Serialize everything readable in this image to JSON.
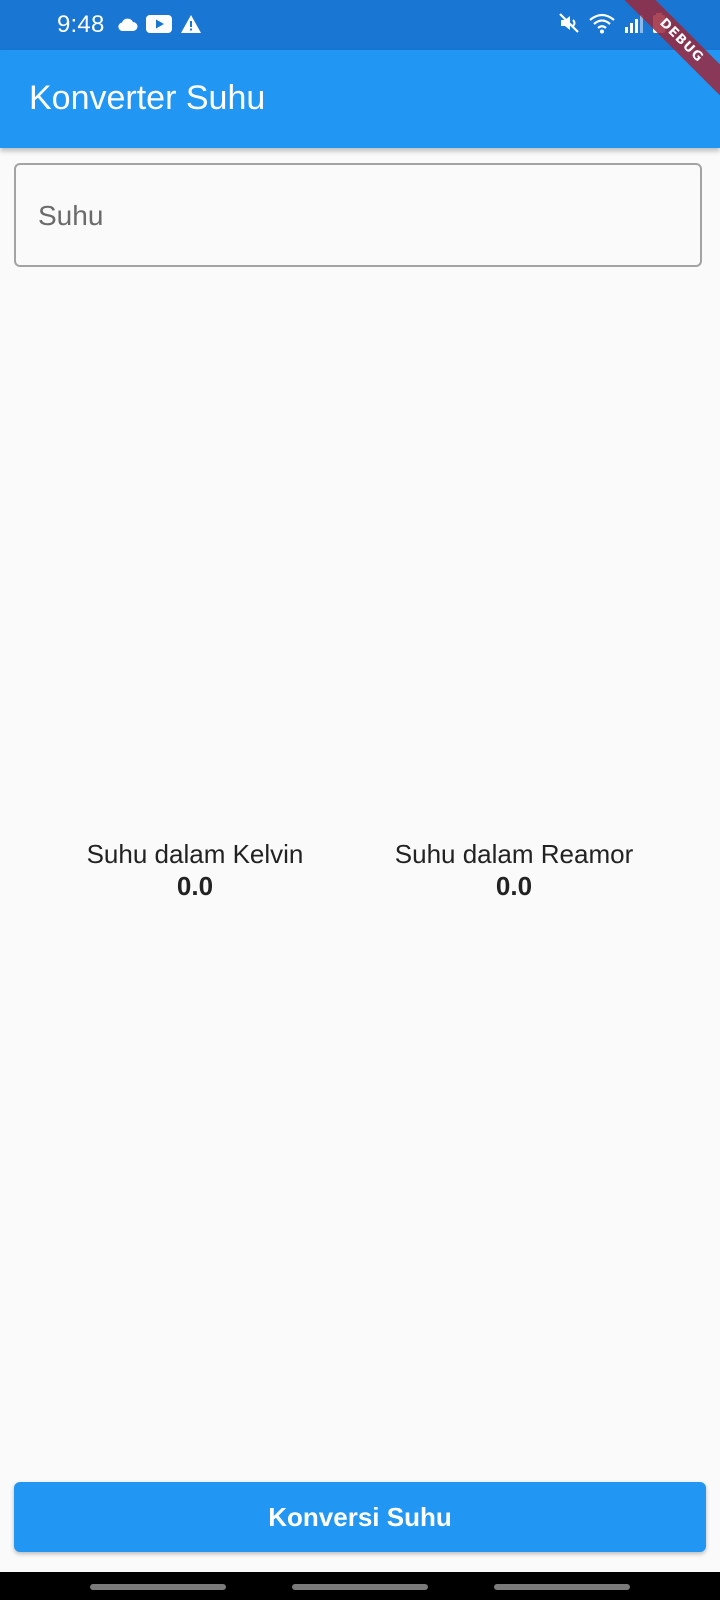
{
  "status_bar": {
    "time": "9:48",
    "left_icons": [
      "cloud-icon",
      "youtube-icon",
      "warning-icon"
    ],
    "right_icons": [
      "mute-icon",
      "wifi-icon",
      "signal-icon",
      "battery-icon"
    ]
  },
  "debug_banner": {
    "label": "DEBUG"
  },
  "app_bar": {
    "title": "Konverter Suhu"
  },
  "input": {
    "value": "",
    "placeholder": "Suhu"
  },
  "results": {
    "kelvin": {
      "label": "Suhu dalam Kelvin",
      "value": "0.0"
    },
    "reamur": {
      "label": "Suhu dalam Reamor",
      "value": "0.0"
    }
  },
  "convert_button": {
    "label": "Konversi Suhu"
  },
  "colors": {
    "primary": "#2196f3",
    "status_bar": "#1976d2",
    "background": "#fafafa",
    "nav_bar": "#000000"
  }
}
